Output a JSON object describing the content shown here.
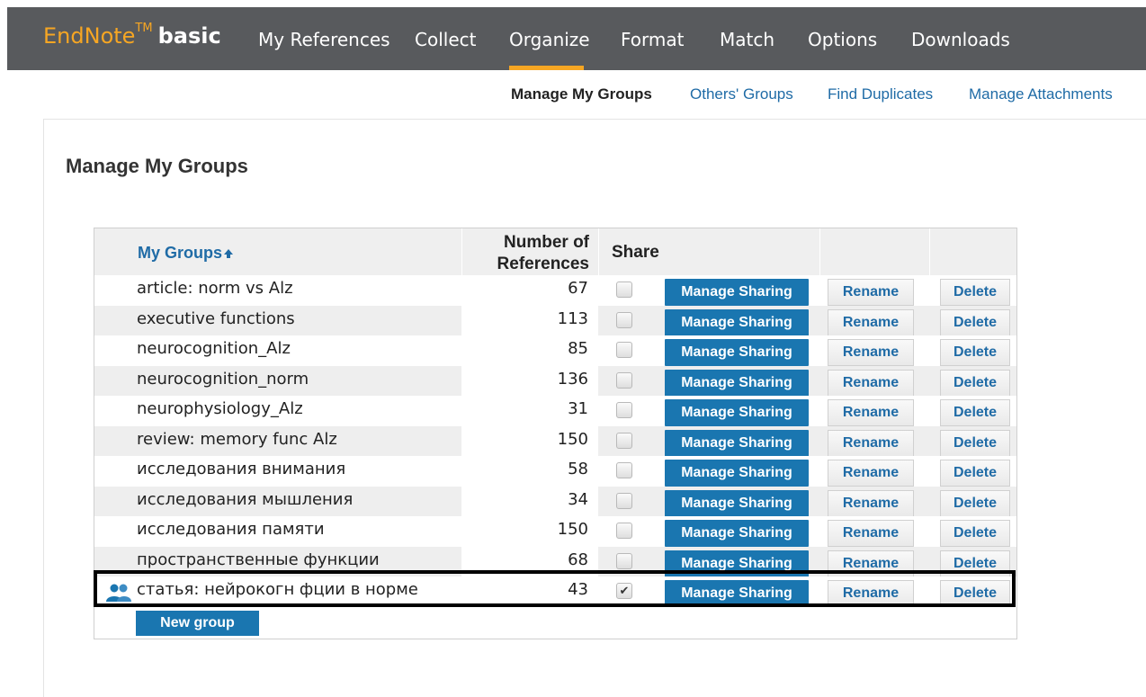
{
  "app": {
    "logo_main": "EndNote",
    "logo_tm": "TM",
    "logo_edition": "basic"
  },
  "nav": {
    "items": [
      {
        "label": "My References"
      },
      {
        "label": "Collect"
      },
      {
        "label": "Organize",
        "active": true
      },
      {
        "label": "Format"
      },
      {
        "label": "Match"
      },
      {
        "label": "Options"
      },
      {
        "label": "Downloads"
      }
    ]
  },
  "subnav": {
    "items": [
      {
        "label": "Manage My Groups",
        "active": true
      },
      {
        "label": "Others' Groups"
      },
      {
        "label": "Find Duplicates"
      },
      {
        "label": "Manage Attachments"
      }
    ]
  },
  "page": {
    "title": "Manage My Groups"
  },
  "table": {
    "headers": {
      "groups": "My Groups",
      "sort_icon": "arrow-up",
      "number_line1": "Number of",
      "number_line2": "References",
      "share": "Share"
    },
    "rows": [
      {
        "name": "article: norm vs Alz",
        "count": "67",
        "shared": false
      },
      {
        "name": "executive functions",
        "count": "113",
        "shared": false
      },
      {
        "name": "neurocognition_Alz",
        "count": "85",
        "shared": false
      },
      {
        "name": "neurocognition_norm",
        "count": "136",
        "shared": false
      },
      {
        "name": "neurophysiology_Alz",
        "count": "31",
        "shared": false
      },
      {
        "name": "review: memory func Alz",
        "count": "150",
        "shared": false
      },
      {
        "name": "исследования внимания",
        "count": "58",
        "shared": false
      },
      {
        "name": "исследования мышления",
        "count": "34",
        "shared": false
      },
      {
        "name": "исследования памяти",
        "count": "150",
        "shared": false
      },
      {
        "name": "пространственные функции",
        "count": "68",
        "shared": false
      },
      {
        "name": "статья: нейрокогн фции в норме",
        "count": "43",
        "shared": true,
        "icon": "shared-users-icon"
      }
    ],
    "buttons": {
      "manage_sharing": "Manage Sharing",
      "rename": "Rename",
      "delete": "Delete"
    },
    "new_group": "New group"
  },
  "colors": {
    "topbar": "#585a5d",
    "accent": "#f6a623",
    "link": "#1f6ba6",
    "button": "#1a76b0"
  }
}
